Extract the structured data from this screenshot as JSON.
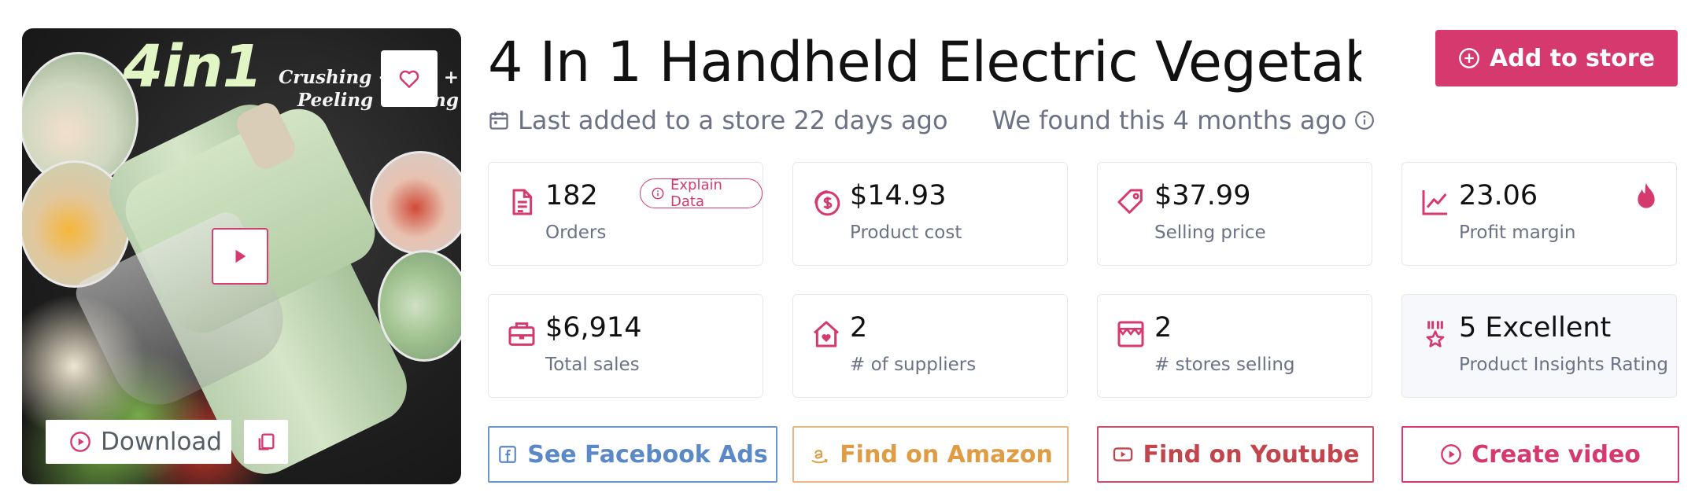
{
  "image": {
    "headline": "4in1",
    "subline_1": "Crushing +     g +",
    "subline_2": "Peeling +     ing",
    "download_label": "Download"
  },
  "product": {
    "title": "4 In 1 Handheld Electric Vegetabl…",
    "last_added": "Last added to a store 22 days ago",
    "found": "We found this 4 months ago"
  },
  "header": {
    "add_to_store_label": "Add to store"
  },
  "stats": [
    {
      "value": "182",
      "label": "Orders",
      "icon": "document-icon"
    },
    {
      "value": "$14.93",
      "label": "Product cost",
      "icon": "coin-icon"
    },
    {
      "value": "$37.99",
      "label": "Selling price",
      "icon": "tag-icon"
    },
    {
      "value": "23.06",
      "label": "Profit margin",
      "icon": "trend-up-icon"
    },
    {
      "value": "$6,914",
      "label": "Total sales",
      "icon": "briefcase-icon"
    },
    {
      "value": "2",
      "label": "# of suppliers",
      "icon": "house-heart-icon"
    },
    {
      "value": "2",
      "label": "# stores selling",
      "icon": "store-icon"
    },
    {
      "value": "5 Excellent",
      "label": "Product Insights Rating",
      "icon": "award-icon"
    }
  ],
  "explain_label": "Explain Data",
  "actions": {
    "facebook": "See Facebook Ads",
    "amazon": "Find on Amazon",
    "youtube": "Find on Youtube",
    "video": "Create video"
  },
  "colors": {
    "accent": "#d6396e",
    "facebook": "#5b88c6",
    "amazon": "#e09c45",
    "youtube": "#c2454d",
    "muted_text": "#6b7286"
  }
}
